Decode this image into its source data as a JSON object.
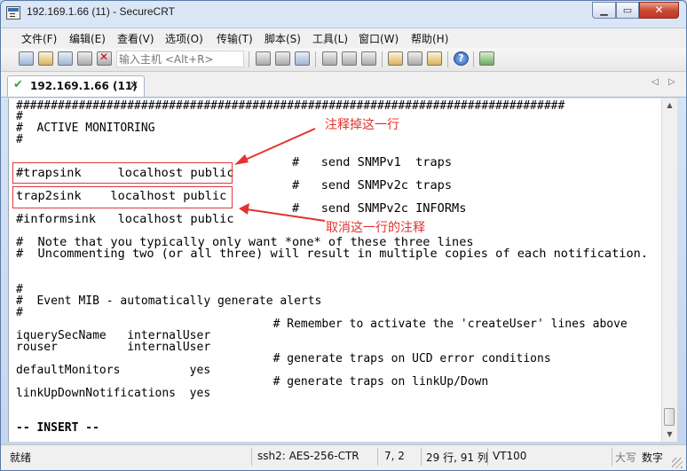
{
  "window": {
    "title": "192.169.1.66 (11) - SecureCRT"
  },
  "menu": [
    "文件(F)",
    "编辑(E)",
    "查看(V)",
    "选项(O)",
    "传输(T)",
    "脚本(S)",
    "工具(L)",
    "窗口(W)",
    "帮助(H)"
  ],
  "toolbar": {
    "input_placeholder": "输入主机 <Alt+R>",
    "icons": [
      "connect-icon",
      "quick-connect-icon",
      "connect-tab-icon",
      "reconnect-icon",
      "disconnect-icon",
      "copy-icon",
      "paste-icon",
      "find-icon",
      "print-icon",
      "print-setup-icon",
      "print-selection-icon",
      "session-options-icon",
      "global-options-icon",
      "keymap-icon",
      "help-icon",
      "sftp-icon"
    ]
  },
  "tab": {
    "label": "192.169.1.66 (11)",
    "close": "✕"
  },
  "terminal": {
    "lines": [
      "###############################################################################",
      "#",
      "#  ACTIVE MONITORING",
      "#",
      "                                      #   send SNMPv1  traps",
      "#trapsink     localhost public",
      "                                      #   send SNMPv2c traps",
      "trap2sink    localhost public",
      "                                      #   send SNMPv2c INFORMs",
      "#informsink   localhost public",
      "#  Note that you typically only want *one* of these three lines",
      "#  Uncommenting two (or all three) will result in multiple copies of each notification.",
      "#",
      "#  Event MIB - automatically generate alerts",
      "#",
      "                                     # Remember to activate the 'createUser' lines above",
      "iquerySecName   internalUser",
      "rouser          internalUser",
      "                                     # generate traps on UCD error conditions",
      "defaultMonitors          yes",
      "                                     # generate traps on linkUp/Down",
      "linkUpDownNotifications  yes",
      "-- INSERT --"
    ],
    "annotations": {
      "top": "注释掉这一行",
      "bottom": "取消这一行的注释"
    },
    "annotation_color": "#e3332f"
  },
  "status": {
    "state": "就绪",
    "cipher": "ssh2: AES-256-CTR",
    "cursor": "7,  2",
    "size": "29 行, 91 列",
    "term": "VT100",
    "caps": "大写",
    "num": "数字"
  }
}
